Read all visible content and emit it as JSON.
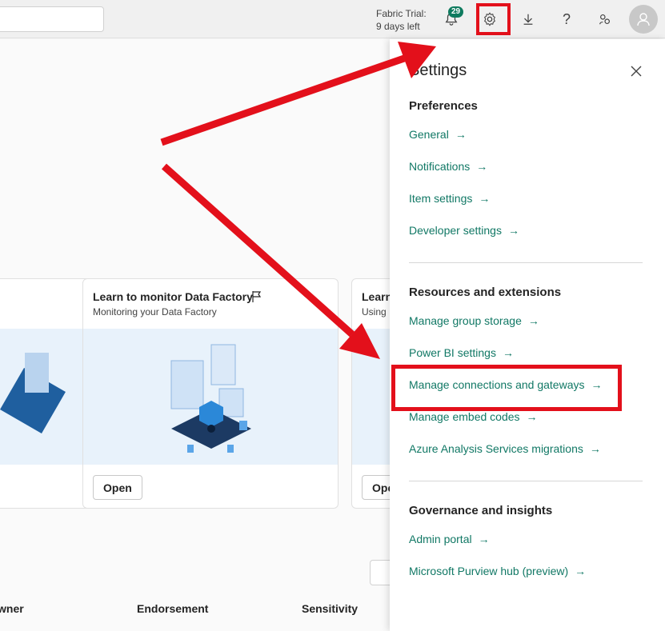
{
  "topbar": {
    "trial_line1": "Fabric Trial:",
    "trial_line2": "9 days left",
    "notification_count": "29"
  },
  "cards": [
    {
      "title": "",
      "subtitle": "",
      "open_label": ""
    },
    {
      "title": "Learn to monitor Data Factory",
      "subtitle": "Monitoring your Data Factory",
      "open_label": "Open"
    },
    {
      "title": "Learn",
      "subtitle": "Using",
      "open_label": "Ope"
    }
  ],
  "table": {
    "columns": [
      "wner",
      "Endorsement",
      "Sensitivity"
    ]
  },
  "settings": {
    "title": "Settings",
    "sections": [
      {
        "heading": "Preferences",
        "items": [
          "General",
          "Notifications",
          "Item settings",
          "Developer settings"
        ]
      },
      {
        "heading": "Resources and extensions",
        "items": [
          "Manage group storage",
          "Power BI settings",
          "Manage connections and gateways",
          "Manage embed codes",
          "Azure Analysis Services migrations"
        ]
      },
      {
        "heading": "Governance and insights",
        "items": [
          "Admin portal",
          "Microsoft Purview hub (preview)"
        ]
      }
    ],
    "arrow_glyph": "→"
  },
  "colors": {
    "link": "#117865",
    "annotation": "#e3101b",
    "badge": "#0f7b5f"
  }
}
